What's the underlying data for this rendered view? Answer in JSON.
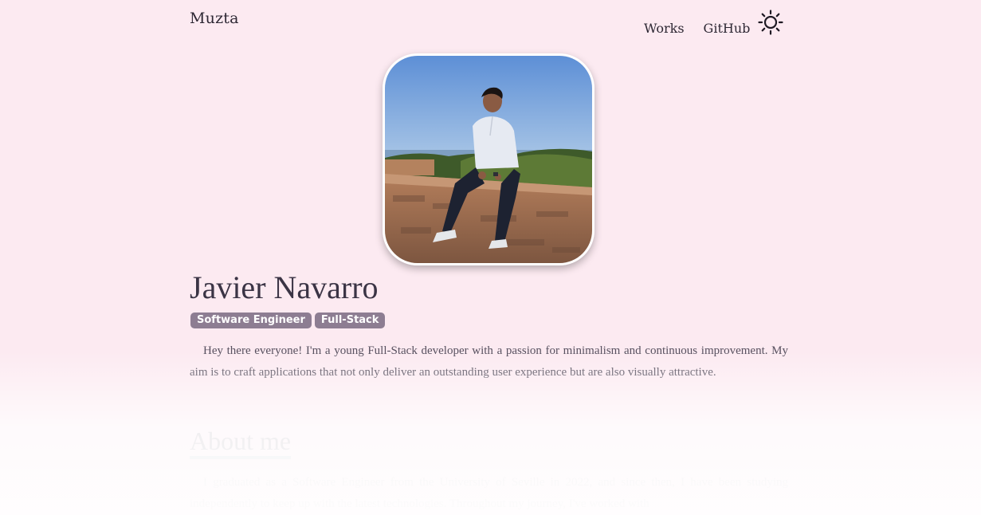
{
  "header": {
    "brand": "Muzta",
    "nav": [
      "Works",
      "GitHub"
    ],
    "theme_icon": "sun-icon"
  },
  "profile": {
    "name": "Javier Navarro",
    "tags": [
      "Software Engineer",
      "Full-Stack"
    ],
    "intro": "Hey there everyone! I'm a young Full-Stack developer with a passion for minimalism and continuous improvement. My aim is to craft applications that not only deliver an outstanding user experience but are also visually attractive."
  },
  "about": {
    "title": "About me",
    "text": "I graduated as a Software Engineer from the University of Seville in 2022, and since then, I have been studying independently to keep up with the latest technologies. Throughout my journey, I've worked with"
  },
  "colors": {
    "background": "#fceaf1",
    "tag_background": "#8d7d92",
    "text": "#2d2733"
  }
}
